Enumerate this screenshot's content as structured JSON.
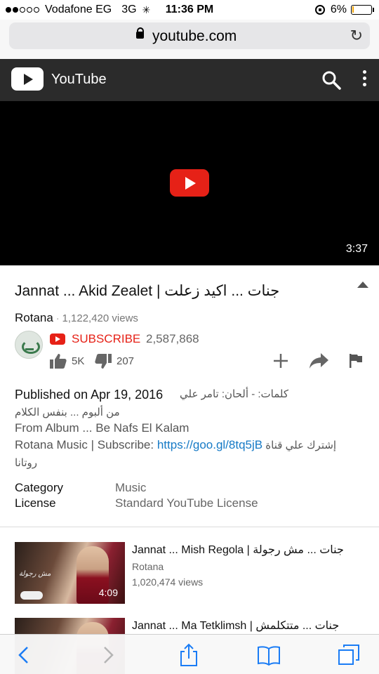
{
  "status_bar": {
    "carrier": "Vodafone EG",
    "network": "3G",
    "time": "11:36 PM",
    "battery": "6%",
    "battery_level": 0.06,
    "battery_color": "#f2a300"
  },
  "address_bar": {
    "url": "youtube.com",
    "icons": [
      "lock-icon",
      "reload-icon"
    ]
  },
  "header": {
    "title": "YouTube",
    "icons": [
      "youtube-logo-icon",
      "search-icon",
      "more-vert-icon"
    ],
    "background": "#2b2b2b"
  },
  "player": {
    "duration": "3:37",
    "play_button_color": "#e62117"
  },
  "video": {
    "title": "Jannat ... Akid Zealet | جنات ... اكيد زعلت",
    "channel": "Rotana",
    "views": "1,122,420 views",
    "subscribe_label": "SUBSCRIBE",
    "subscriber_count": "2,587,868",
    "likes": "5K",
    "dislikes": "207",
    "accent_color": "#e62117",
    "link_color": "#167ac6"
  },
  "description": {
    "published": "Published on Apr 19, 2016",
    "credit": "كلمات: - ألحان: تامر علي",
    "album_ar": "من ألبوم ... بنفس الكلام",
    "album_en": "From Album ... Be Nafs El Kalam",
    "subscribe_prefix": "Rotana Music | Subscribe: ",
    "subscribe_link": "https://goo.gl/8tq5jB",
    "subscribe_ar": " إشترك علي قناة",
    "channel_ar": "روتانا"
  },
  "meta": {
    "category_label": "Category",
    "category_value": "Music",
    "license_label": "License",
    "license_value": "Standard YouTube License"
  },
  "related": [
    {
      "title": "Jannat ... Mish Regola | جنات ... مش رجولة",
      "channel": "Rotana",
      "views": "1,020,474 views",
      "duration": "4:09",
      "thumb_caption": "مش رجولة"
    },
    {
      "title": "Jannat ... Ma Tetklimsh | جنات ... متتكلمش"
    }
  ],
  "toolbar": {
    "icons": [
      "back-icon",
      "forward-icon",
      "share-icon",
      "bookmarks-icon",
      "tabs-icon"
    ],
    "tint": "#1a7cf5"
  }
}
